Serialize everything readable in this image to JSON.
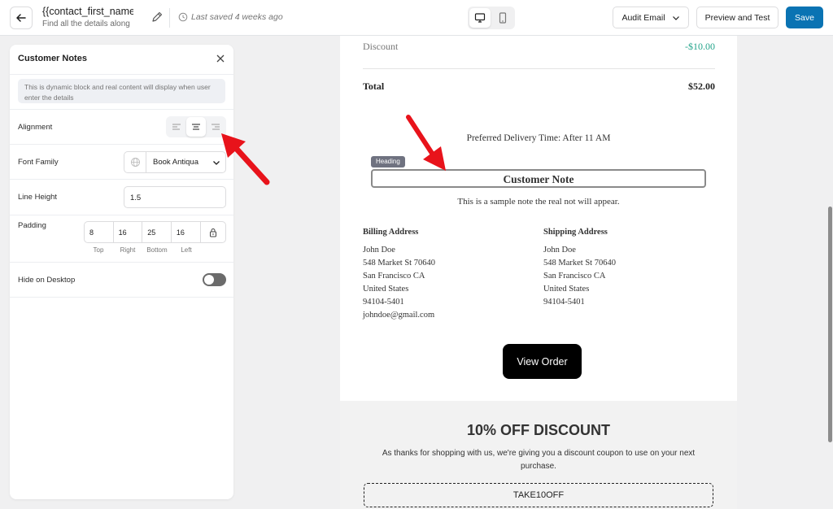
{
  "header": {
    "title": "{{contact_first_name}}",
    "subtitle": "Find all the details along",
    "saved_status": "Last saved 4 weeks ago",
    "audit_label": "Audit Email",
    "preview_label": "Preview and Test",
    "save_label": "Save"
  },
  "panel": {
    "title": "Customer Notes",
    "info": "This is dynamic block and real content will display when user enter the details",
    "alignment_label": "Alignment",
    "alignment_selected": "center",
    "font_family_label": "Font Family",
    "font_family_value": "Book Antiqua",
    "line_height_label": "Line Height",
    "line_height_value": "1.5",
    "padding_label": "Padding",
    "padding": {
      "top": "8",
      "right": "16",
      "bottom": "25",
      "left": "16",
      "top_label": "Top",
      "right_label": "Right",
      "bottom_label": "Bottom",
      "left_label": "Left"
    },
    "hide_desktop_label": "Hide on Desktop",
    "hide_desktop_on": false
  },
  "email": {
    "discount_label": "Discount",
    "discount_value": "-$10.00",
    "total_label": "Total",
    "total_value": "$52.00",
    "delivery": "Preferred Delivery Time: After 11 AM",
    "heading_tag": "Heading",
    "note_heading": "Customer Note",
    "note_body": "This is a sample note the real not will appear.",
    "billing": {
      "title": "Billing Address",
      "name": "John Doe",
      "street": "548 Market St 70640",
      "city": "San Francisco CA",
      "country": "United States",
      "zip": "94104-5401",
      "email": "johndoe@gmail.com"
    },
    "shipping": {
      "title": "Shipping Address",
      "name": "John Doe",
      "street": "548 Market St 70640",
      "city": "San Francisco CA",
      "country": "United States",
      "zip": "94104-5401"
    },
    "view_order": "View Order",
    "promo_title": "10% OFF DISCOUNT",
    "promo_text": "As thanks for shopping with us, we're giving you a discount coupon to use on your next purchase.",
    "coupon": "TAKE10OFF"
  },
  "colors": {
    "accent": "#0a73b3",
    "discount": "#24a48b",
    "arrow": "#e8131b"
  }
}
